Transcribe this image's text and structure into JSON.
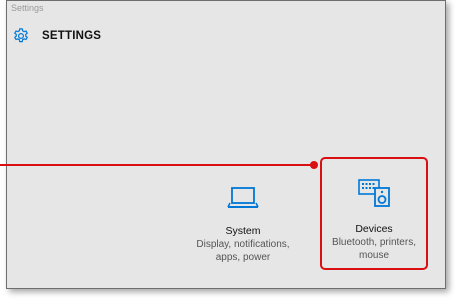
{
  "window": {
    "title": "Settings"
  },
  "header": {
    "title": "SETTINGS",
    "icon": "gear-icon"
  },
  "tiles": [
    {
      "id": "system",
      "icon": "laptop-icon",
      "title": "System",
      "description_line1": "Display, notifications,",
      "description_line2": "apps, power"
    },
    {
      "id": "devices",
      "icon": "devices-icon",
      "title": "Devices",
      "description_line1": "Bluetooth, printers,",
      "description_line2": "mouse"
    }
  ],
  "colors": {
    "accent": "#0078d7",
    "highlight": "#d90f12",
    "window_bg": "#e6e6e6"
  }
}
